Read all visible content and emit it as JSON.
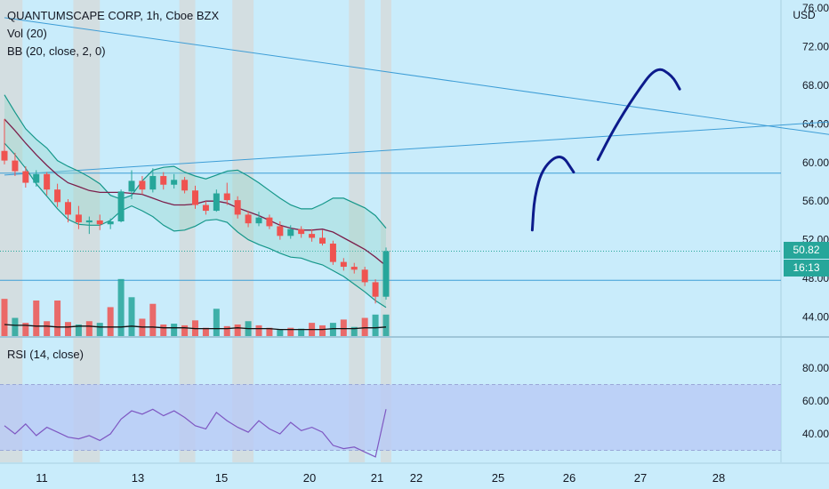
{
  "legend": {
    "title": "QUANTUMSCAPE CORP, 1h, Cboe BZX",
    "vol": "Vol (20)",
    "bb": "BB (20, close, 2, 0)",
    "rsi": "RSI (14, close)"
  },
  "currency": "USD",
  "price_tag": {
    "last": "50.82",
    "countdown": "16:13"
  },
  "colors": {
    "background": "#c9ecfb",
    "bull": "#26a69a",
    "bear": "#ef5350",
    "basis": "#7b1f4b",
    "band": "#15978a",
    "trendline": "#3d9dd6",
    "drawing": "#0d1b8c",
    "rsi_line": "#7e57c2",
    "rsi_band": "#b7c8f5"
  },
  "chart_data": [
    {
      "type": "candlestick",
      "title": "QUANTUMSCAPE CORP, 1h, Cboe BZX",
      "ylabel": "USD",
      "x_tick_labels": [
        "11",
        "13",
        "15",
        "20",
        "21",
        "22",
        "25",
        "26",
        "27",
        "28"
      ],
      "y_ticks": [
        44,
        48,
        52,
        56,
        60,
        64,
        68,
        72,
        76
      ],
      "ylim": [
        41.5,
        76.5
      ],
      "last_price": 50.82,
      "bb_upper": [
        67.0,
        65.2,
        63.5,
        62.4,
        61.5,
        60.2,
        59.6,
        59.1,
        58.5,
        57.8,
        56.6,
        56.2,
        56.6,
        58.1,
        59.2,
        59.5,
        59.6,
        59.0,
        58.6,
        58.3,
        58.7,
        59.1,
        59.2,
        58.6,
        57.9,
        57.1,
        56.3,
        55.6,
        55.2,
        55.2,
        55.7,
        56.3,
        56.3,
        55.8,
        55.3,
        54.5,
        53.2
      ],
      "bb_basis": [
        64.5,
        63.3,
        62.0,
        60.8,
        59.7,
        58.7,
        57.9,
        57.5,
        57.1,
        56.9,
        56.9,
        56.9,
        56.8,
        56.7,
        56.3,
        55.9,
        55.6,
        55.6,
        55.7,
        56.0,
        56.0,
        55.8,
        55.3,
        54.9,
        54.5,
        54.0,
        53.5,
        53.2,
        53.0,
        53.0,
        53.1,
        52.8,
        52.2,
        51.6,
        51.0,
        50.2,
        49.3
      ],
      "bb_lower": [
        62.0,
        60.8,
        59.4,
        57.8,
        56.5,
        55.2,
        54.1,
        53.6,
        53.5,
        53.5,
        54.0,
        55.0,
        55.5,
        55.0,
        54.4,
        53.5,
        52.9,
        53.0,
        53.4,
        54.0,
        54.1,
        53.8,
        52.8,
        52.0,
        51.5,
        51.1,
        50.6,
        50.2,
        50.1,
        49.7,
        49.4,
        48.8,
        48.2,
        47.4,
        46.6,
        45.7,
        45.0
      ],
      "candles": [
        {
          "o": 61.2,
          "h": 64.5,
          "l": 59.8,
          "c": 60.2
        },
        {
          "o": 60.2,
          "h": 61.0,
          "l": 58.6,
          "c": 59.1
        },
        {
          "o": 59.1,
          "h": 59.6,
          "l": 57.4,
          "c": 57.9
        },
        {
          "o": 57.9,
          "h": 59.2,
          "l": 57.5,
          "c": 58.8
        },
        {
          "o": 58.8,
          "h": 59.0,
          "l": 56.6,
          "c": 57.2
        },
        {
          "o": 57.2,
          "h": 57.8,
          "l": 55.4,
          "c": 55.9
        },
        {
          "o": 55.9,
          "h": 56.2,
          "l": 53.8,
          "c": 54.6
        },
        {
          "o": 54.6,
          "h": 55.5,
          "l": 53.1,
          "c": 53.8
        },
        {
          "o": 53.8,
          "h": 54.4,
          "l": 52.6,
          "c": 54.0
        },
        {
          "o": 54.0,
          "h": 54.6,
          "l": 53.0,
          "c": 53.6
        },
        {
          "o": 53.6,
          "h": 54.2,
          "l": 53.1,
          "c": 53.9
        },
        {
          "o": 53.9,
          "h": 57.2,
          "l": 53.8,
          "c": 57.0
        },
        {
          "o": 57.0,
          "h": 59.2,
          "l": 56.2,
          "c": 58.1
        },
        {
          "o": 58.1,
          "h": 58.6,
          "l": 56.7,
          "c": 57.2
        },
        {
          "o": 57.2,
          "h": 59.4,
          "l": 56.9,
          "c": 58.6
        },
        {
          "o": 58.6,
          "h": 59.0,
          "l": 57.2,
          "c": 57.7
        },
        {
          "o": 57.7,
          "h": 58.8,
          "l": 57.3,
          "c": 58.2
        },
        {
          "o": 58.2,
          "h": 58.5,
          "l": 56.8,
          "c": 57.1
        },
        {
          "o": 57.1,
          "h": 57.6,
          "l": 55.2,
          "c": 55.6
        },
        {
          "o": 55.6,
          "h": 56.0,
          "l": 54.6,
          "c": 55.0
        },
        {
          "o": 55.0,
          "h": 57.2,
          "l": 54.9,
          "c": 56.8
        },
        {
          "o": 56.8,
          "h": 57.9,
          "l": 55.6,
          "c": 56.1
        },
        {
          "o": 56.1,
          "h": 56.5,
          "l": 54.2,
          "c": 54.6
        },
        {
          "o": 54.6,
          "h": 55.0,
          "l": 53.3,
          "c": 53.7
        },
        {
          "o": 53.7,
          "h": 54.9,
          "l": 53.4,
          "c": 54.3
        },
        {
          "o": 54.3,
          "h": 54.6,
          "l": 53.1,
          "c": 53.4
        },
        {
          "o": 53.4,
          "h": 53.9,
          "l": 52.0,
          "c": 52.4
        },
        {
          "o": 52.4,
          "h": 53.5,
          "l": 52.1,
          "c": 53.1
        },
        {
          "o": 53.1,
          "h": 53.4,
          "l": 52.2,
          "c": 52.6
        },
        {
          "o": 52.6,
          "h": 53.1,
          "l": 51.8,
          "c": 52.2
        },
        {
          "o": 52.2,
          "h": 53.0,
          "l": 51.4,
          "c": 51.6
        },
        {
          "o": 51.6,
          "h": 51.9,
          "l": 49.4,
          "c": 49.7
        },
        {
          "o": 49.7,
          "h": 50.1,
          "l": 48.8,
          "c": 49.2
        },
        {
          "o": 49.2,
          "h": 49.6,
          "l": 48.5,
          "c": 48.9
        },
        {
          "o": 48.9,
          "h": 49.2,
          "l": 47.2,
          "c": 47.6
        },
        {
          "o": 47.6,
          "h": 47.9,
          "l": 45.4,
          "c": 46.1
        },
        {
          "o": 46.1,
          "h": 51.2,
          "l": 45.8,
          "c": 50.82
        }
      ],
      "volume": [
        {
          "v": 4.5,
          "up": false
        },
        {
          "v": 2.2,
          "up": true
        },
        {
          "v": 1.6,
          "up": false
        },
        {
          "v": 4.3,
          "up": false
        },
        {
          "v": 1.8,
          "up": false
        },
        {
          "v": 4.3,
          "up": false
        },
        {
          "v": 1.7,
          "up": false
        },
        {
          "v": 1.4,
          "up": true
        },
        {
          "v": 1.8,
          "up": false
        },
        {
          "v": 1.6,
          "up": true
        },
        {
          "v": 3.5,
          "up": false
        },
        {
          "v": 6.9,
          "up": true
        },
        {
          "v": 4.7,
          "up": true
        },
        {
          "v": 2.1,
          "up": false
        },
        {
          "v": 3.9,
          "up": false
        },
        {
          "v": 1.4,
          "up": false
        },
        {
          "v": 1.5,
          "up": true
        },
        {
          "v": 1.3,
          "up": false
        },
        {
          "v": 1.9,
          "up": false
        },
        {
          "v": 1.0,
          "up": false
        },
        {
          "v": 3.3,
          "up": true
        },
        {
          "v": 1.2,
          "up": false
        },
        {
          "v": 1.4,
          "up": false
        },
        {
          "v": 1.8,
          "up": true
        },
        {
          "v": 1.3,
          "up": false
        },
        {
          "v": 1.0,
          "up": false
        },
        {
          "v": 0.8,
          "up": true
        },
        {
          "v": 1.0,
          "up": false
        },
        {
          "v": 0.9,
          "up": true
        },
        {
          "v": 1.6,
          "up": false
        },
        {
          "v": 1.3,
          "up": false
        },
        {
          "v": 1.6,
          "up": true
        },
        {
          "v": 2.0,
          "up": false
        },
        {
          "v": 1.1,
          "up": true
        },
        {
          "v": 2.2,
          "up": false
        },
        {
          "v": 2.6,
          "up": true
        },
        {
          "v": 2.6,
          "up": true
        }
      ],
      "volume_ma": [
        1.4,
        1.3,
        1.3,
        1.2,
        1.2,
        1.1,
        1.1,
        1.2,
        1.2,
        1.1,
        1.1,
        1.1,
        1.2,
        1.1,
        1.1,
        1.0,
        1.0,
        1.0,
        0.9,
        0.9,
        0.9,
        0.9,
        1.0,
        0.9,
        0.9,
        0.9,
        0.8,
        0.8,
        0.8,
        0.8,
        0.8,
        0.9,
        0.9,
        0.9,
        1.0,
        1.0,
        1.1
      ],
      "horizontal_lines": [
        58.9,
        47.8
      ],
      "last_price_line": 50.82,
      "trendlines": [
        {
          "from": {
            "bar": 0,
            "price": 75.0
          },
          "to": {
            "bar": 99,
            "price": 59.6
          }
        },
        {
          "from": {
            "bar": 0,
            "price": 58.7
          },
          "to": {
            "bar": 99,
            "price": 65.7
          }
        }
      ],
      "drawings": [
        {
          "type": "freehand",
          "points": [
            [
              49.8,
              53.0
            ],
            [
              50.0,
              56.5
            ],
            [
              50.8,
              59.5
            ],
            [
              52.5,
              61.0
            ],
            [
              53.7,
              59.0
            ]
          ]
        },
        {
          "type": "freehand",
          "points": [
            [
              56.0,
              60.3
            ],
            [
              57.5,
              63.5
            ],
            [
              59.5,
              67.0
            ],
            [
              61.5,
              70.0
            ],
            [
              63.0,
              69.0
            ],
            [
              63.7,
              67.6
            ]
          ]
        }
      ],
      "session_shading": true
    },
    {
      "type": "line",
      "title": "RSI (14, close)",
      "y_ticks": [
        40,
        60,
        80
      ],
      "ylim": [
        25,
        95
      ],
      "band": [
        30,
        70
      ],
      "values": [
        45,
        40,
        46,
        39,
        44,
        41,
        38,
        37,
        39,
        36,
        40,
        49,
        54,
        52,
        55,
        51,
        54,
        50,
        45,
        43,
        53,
        48,
        44,
        41,
        48,
        43,
        40,
        47,
        42,
        44,
        41,
        33,
        31,
        32,
        29,
        26,
        55
      ]
    }
  ]
}
